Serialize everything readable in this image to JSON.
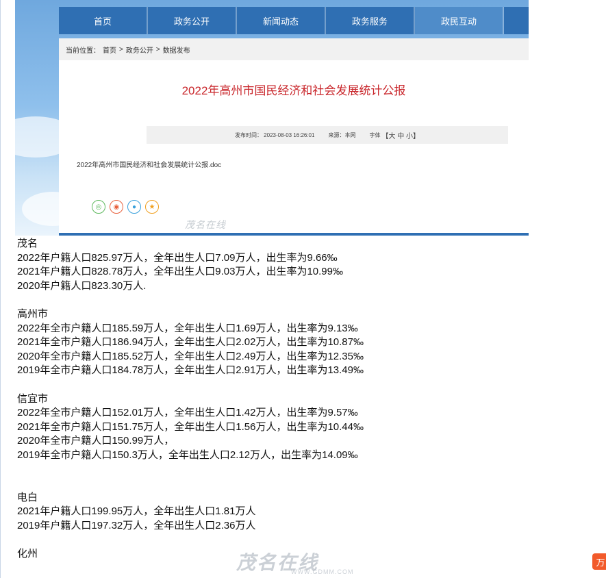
{
  "site": {
    "nav": [
      "首页",
      "政务公开",
      "新闻动态",
      "政务服务",
      "政民互动"
    ],
    "nav_active_index": 4,
    "breadcrumb": {
      "prefix": "当前位置：",
      "items": [
        "首页",
        "政务公开",
        "数据发布"
      ],
      "separator": ">"
    },
    "article_title": "2022年高州市国民经济和社会发展统计公报",
    "meta": {
      "published": "发布时间：  2023-08-03 16:26:01",
      "source": "来源：本网",
      "font_label": "字体",
      "font_sizes": "【大 中 小】"
    },
    "attachment": "2022年高州市国民经济和社会发展统计公报.doc",
    "share_icons": [
      "wechat-icon",
      "weibo-icon",
      "qq-icon",
      "favorite-icon"
    ],
    "watermark": "茂名在线"
  },
  "sections": [
    {
      "name": "茂名",
      "lines": [
        "2022年户籍人口825.97万人，全年出生人口7.09万人，出生率为9.66‰",
        "2021年户籍人口828.78万人，全年出生人口9.03万人，出生率为10.99‰",
        "2020年户籍人口823.30万人."
      ]
    },
    {
      "name": "高州市",
      "lines": [
        "2022年全市户籍人口185.59万人，全年出生人口1.69万人，出生率为9.13‰",
        "2021年全市户籍人口186.94万人，全年出生人口2.02万人，出生率为10.87‰",
        "2020年全市户籍人口185.52万人，全年出生人口2.49万人，出生率为12.35‰",
        "2019年全市户籍人口184.78万人，全年出生人口2.91万人，出生率为13.49‰"
      ]
    },
    {
      "name": "信宜市",
      "lines": [
        "2022年全市户籍人口152.01万人，全年出生人口1.42万人，出生率为9.57‰",
        "2021年全市户籍人口151.75万人，全年出生人口1.56万人，出生率为10.44‰",
        "2020年全市户籍人口150.99万人，",
        "2019年全市户籍人口150.3万人，全年出生人口2.12万人，出生率为14.09‰"
      ]
    },
    {
      "name": "电白",
      "lines": [
        "2021年户籍人口199.95万人，全年出生人口1.81万人",
        "2019年户籍人口197.32万人，全年出生人口2.36万人"
      ]
    },
    {
      "name": "化州",
      "lines": []
    }
  ],
  "watermark_big": {
    "logo": "茂名在线",
    "url": "WWW.GDMM.COM"
  },
  "corner_button": "万"
}
